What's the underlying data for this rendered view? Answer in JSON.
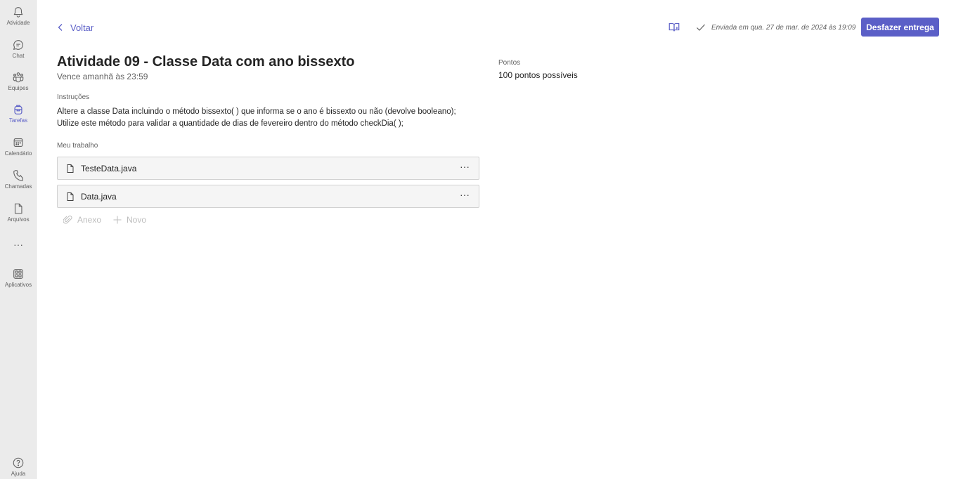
{
  "rail": {
    "items": [
      {
        "label": "Atividade",
        "icon": "bell-icon"
      },
      {
        "label": "Chat",
        "icon": "chat-icon"
      },
      {
        "label": "Equipes",
        "icon": "teams-icon"
      },
      {
        "label": "Tarefas",
        "icon": "backpack-icon",
        "active": true
      },
      {
        "label": "Calendário",
        "icon": "calendar-icon"
      },
      {
        "label": "Chamadas",
        "icon": "phone-icon"
      },
      {
        "label": "Arquivos",
        "icon": "file-icon"
      },
      {
        "label": "Aplicativos",
        "icon": "apps-icon"
      }
    ],
    "more": "···",
    "help_label": "Ajuda"
  },
  "header": {
    "back_label": "Voltar",
    "submitted_text": "Enviada em qua. 27 de mar. de 2024 às 19:09",
    "undo_button": "Desfazer entrega"
  },
  "assignment": {
    "title": "Atividade 09 - Classe Data com ano bissexto",
    "due": "Vence amanhã às 23:59",
    "instructions_label": "Instruções",
    "instructions": [
      "Altere a classe Data incluindo o método bissexto( ) que informa se o ano é bissexto ou não (devolve booleano);",
      "Utilize este método para validar a quantidade de dias de fevereiro dentro do método checkDia( );"
    ],
    "my_work_label": "Meu trabalho",
    "files": [
      {
        "name": "TesteData.java",
        "more": "···"
      },
      {
        "name": "Data.java",
        "more": "···"
      }
    ],
    "attach_label": "Anexo",
    "new_label": "Novo"
  },
  "points": {
    "label": "Pontos",
    "value": "100 pontos possíveis"
  },
  "colors": {
    "accent": "#5b5fc7",
    "rail_bg": "#ebebeb",
    "muted_text": "#616161"
  }
}
